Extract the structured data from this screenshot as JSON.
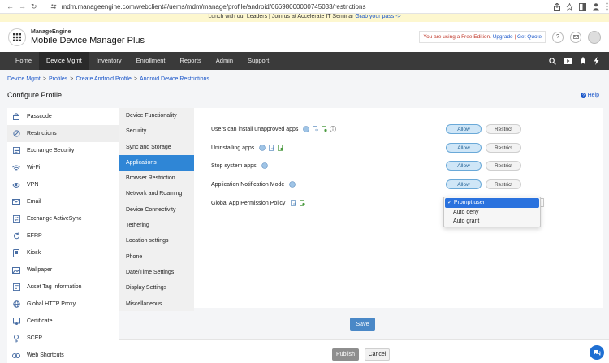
{
  "browser": {
    "url": "mdm.manageengine.com/webclient#/uems/mdm/manage/profile/android/66698000000745033/restrictions"
  },
  "banner": {
    "text": "Lunch with our Leaders | Join us at Accelerate IT Seminar",
    "link": "Grab your pass ->"
  },
  "header": {
    "brand_small": "ManageEngine",
    "brand_big": "Mobile Device Manager Plus",
    "free_edition_text": "You are using a Free Edition.",
    "upgrade_label": "Upgrade",
    "get_quote_label": "Get Quote",
    "separator": "|"
  },
  "nav": {
    "items": [
      {
        "label": "Home"
      },
      {
        "label": "Device Mgmt"
      },
      {
        "label": "Inventory"
      },
      {
        "label": "Enrollment"
      },
      {
        "label": "Reports"
      },
      {
        "label": "Admin"
      },
      {
        "label": "Support"
      }
    ]
  },
  "breadcrumb": {
    "items": [
      "Device Mgmt",
      "Profiles",
      "Create Android Profile",
      "Android Device Restrictions"
    ],
    "separator": ">"
  },
  "page": {
    "title": "Configure Profile",
    "help_label": "Help"
  },
  "sidebar": {
    "items": [
      {
        "label": "Passcode",
        "icon": "lock-icon"
      },
      {
        "label": "Restrictions",
        "icon": "ban-icon"
      },
      {
        "label": "Exchange Security",
        "icon": "shield-icon"
      },
      {
        "label": "Wi-Fi",
        "icon": "wifi-icon"
      },
      {
        "label": "VPN",
        "icon": "vpn-icon"
      },
      {
        "label": "Email",
        "icon": "mail-icon"
      },
      {
        "label": "Exchange ActiveSync",
        "icon": "sync-icon"
      },
      {
        "label": "EFRP",
        "icon": "refresh-icon"
      },
      {
        "label": "Kiosk",
        "icon": "kiosk-icon"
      },
      {
        "label": "Wallpaper",
        "icon": "image-icon"
      },
      {
        "label": "Asset Tag Information",
        "icon": "tag-icon"
      },
      {
        "label": "Global HTTP Proxy",
        "icon": "globe-icon"
      },
      {
        "label": "Certificate",
        "icon": "certificate-icon"
      },
      {
        "label": "SCEP",
        "icon": "key-icon"
      },
      {
        "label": "Web Shortcuts",
        "icon": "link-icon"
      }
    ]
  },
  "submenu": {
    "items": [
      {
        "label": "Device Functionality"
      },
      {
        "label": "Security"
      },
      {
        "label": "Sync and Storage"
      },
      {
        "label": "Applications"
      },
      {
        "label": "Browser Restriction"
      },
      {
        "label": "Network and Roaming"
      },
      {
        "label": "Device Connectivity"
      },
      {
        "label": "Tethering"
      },
      {
        "label": "Location settings"
      },
      {
        "label": "Phone"
      },
      {
        "label": "Date/Time Settings"
      },
      {
        "label": "Display Settings"
      },
      {
        "label": "Miscellaneous"
      }
    ]
  },
  "content": {
    "rows": [
      {
        "label": "Users can install unapproved apps",
        "allow": "Allow",
        "restrict": "Restrict"
      },
      {
        "label": "Uninstalling apps",
        "allow": "Allow",
        "restrict": "Restrict"
      },
      {
        "label": "Stop system apps",
        "allow": "Allow",
        "restrict": "Restrict"
      },
      {
        "label": "Application Notification Mode",
        "allow": "Allow",
        "restrict": "Restrict"
      }
    ],
    "permission_label": "Global App Permission Policy",
    "permission_options": [
      "Prompt user",
      "Auto deny",
      "Auto grant"
    ],
    "selected_check": "✓"
  },
  "actions": {
    "save": "Save",
    "publish": "Publish",
    "cancel": "Cancel"
  },
  "colors": {
    "accent": "#2f86d6",
    "nav_bg": "#3a3a3a",
    "allow_bg": "#cfe6f7"
  }
}
